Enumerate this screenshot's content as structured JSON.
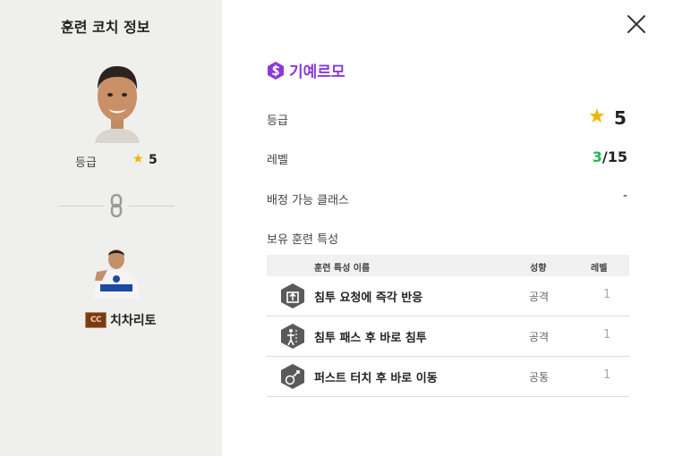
{
  "left_panel": {
    "title": "훈련 코치 정보",
    "grade_label": "등급",
    "grade_value": "5",
    "player_badge": "CC",
    "player_name": "치차리토"
  },
  "detail": {
    "coach_name": "기예르모",
    "grade_label": "등급",
    "grade_value": "5",
    "level_label": "레벨",
    "level_current": "3",
    "level_max": "/15",
    "class_label": "배정 가능 클래스",
    "class_value": "-",
    "traits_label": "보유 훈련 특성"
  },
  "table": {
    "col_name": "훈련 특성 이름",
    "col_type": "성향",
    "col_level": "레벨",
    "rows": [
      {
        "icon": "run-request-icon",
        "name": "침투 요청에 즉각 반응",
        "type": "공격",
        "level": "1"
      },
      {
        "icon": "run-pass-icon",
        "name": "침투 패스 후 바로 침투",
        "type": "공격",
        "level": "1"
      },
      {
        "icon": "first-touch-icon",
        "name": "퍼스트 터치 후 바로 이동",
        "type": "공통",
        "level": "1"
      }
    ]
  },
  "colors": {
    "accent_purple": "#8a3ad8",
    "star_gold": "#f0b400",
    "level_green": "#1db954",
    "left_panel_bg": "#efefed"
  }
}
